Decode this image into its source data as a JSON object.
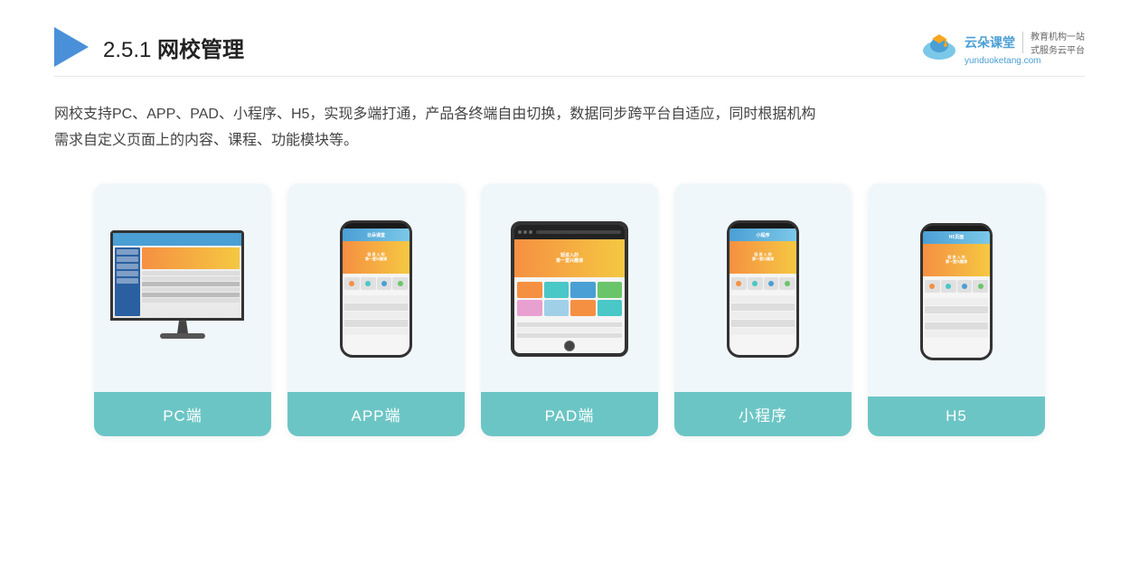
{
  "header": {
    "title_prefix": "2.5.1 ",
    "title_bold": "网校管理",
    "brand": {
      "name_line1": "云朵课堂",
      "name_line2": "yunduoketang.com",
      "slogan_line1": "教育机构一站",
      "slogan_line2": "式服务云平台"
    }
  },
  "description": {
    "line1": "网校支持PC、APP、PAD、小程序、H5，实现多端打通，产品各终端自由切换，数据同步跨平台自适应，同时根据机构",
    "line2": "需求自定义页面上的内容、课程、功能模块等。"
  },
  "cards": [
    {
      "id": "pc",
      "label": "PC端",
      "type": "monitor"
    },
    {
      "id": "app",
      "label": "APP端",
      "type": "phone"
    },
    {
      "id": "pad",
      "label": "PAD端",
      "type": "pad"
    },
    {
      "id": "miniprogram",
      "label": "小程序",
      "type": "phone"
    },
    {
      "id": "h5",
      "label": "H5",
      "type": "phone"
    }
  ]
}
